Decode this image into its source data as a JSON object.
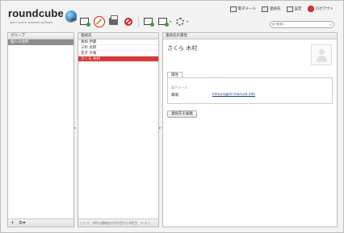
{
  "header": {
    "logo_text": "roundcube",
    "logo_sub": "open source webmail software",
    "nav": [
      {
        "label": "電子メール",
        "icon": "mail-icon"
      },
      {
        "label": "連絡先",
        "icon": "address-book-icon"
      },
      {
        "label": "設定",
        "icon": "settings-icon"
      },
      {
        "label": "ログアウト",
        "icon": "logout-icon"
      }
    ]
  },
  "search": {
    "placeholder": "検索..."
  },
  "groups": {
    "header": "グループ",
    "items": [
      {
        "label": "個人の住所"
      }
    ],
    "footer": {
      "add": "+",
      "options": "⚙▾"
    }
  },
  "contacts": {
    "header": "連絡先",
    "items": [
      {
        "label": "真如 伊藤"
      },
      {
        "label": "三杉 太郎"
      },
      {
        "label": "花子 大塚"
      },
      {
        "label": "さくら 木村",
        "selected": true
      }
    ],
    "footer": {
      "pager_prev": "| <  <",
      "status": "4件の連絡先の1件目から4件目",
      "pager_next": ">  > |"
    }
  },
  "details": {
    "header": "連絡先の属性",
    "name": "さくら 木村",
    "tab": "属性",
    "section_label": "電子メール",
    "field_label": "職場",
    "field_value": "kimura@rk-manual.info",
    "edit_button": "連絡先を編集"
  }
}
